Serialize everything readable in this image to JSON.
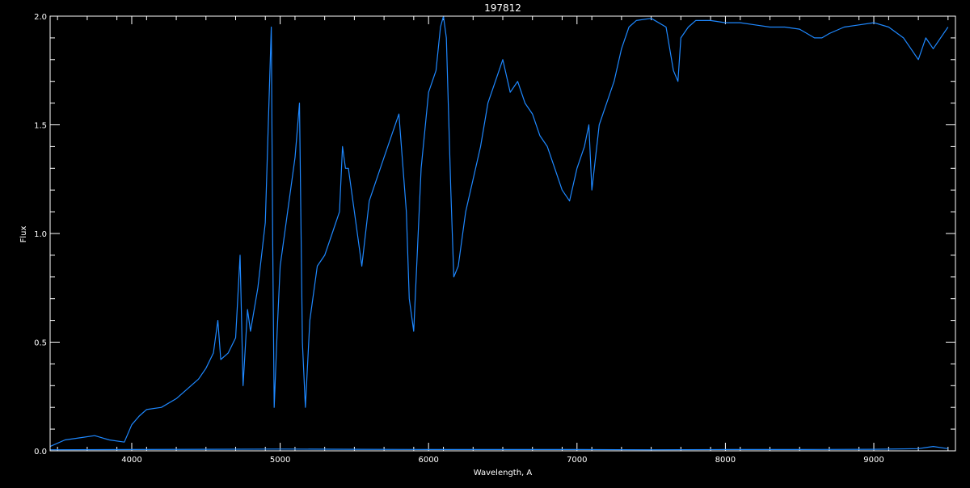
{
  "chart_data": {
    "type": "line",
    "title": "197812",
    "xlabel": "Wavelength, A",
    "ylabel": "Flux",
    "xlim": [
      3450,
      9550
    ],
    "ylim": [
      0.0,
      2.0
    ],
    "x_ticks": [
      {
        "value": 4000,
        "label": "4000"
      },
      {
        "value": 5000,
        "label": "5000"
      },
      {
        "value": 6000,
        "label": "6000"
      },
      {
        "value": 7000,
        "label": "7000"
      },
      {
        "value": 8000,
        "label": "8000"
      },
      {
        "value": 9000,
        "label": "9000"
      }
    ],
    "y_ticks": [
      {
        "value": 0.0,
        "label": "0.0"
      },
      {
        "value": 0.5,
        "label": "0.5"
      },
      {
        "value": 1.0,
        "label": "1.0"
      },
      {
        "value": 1.5,
        "label": "1.5"
      },
      {
        "value": 2.0,
        "label": "2.0"
      }
    ],
    "grid": false,
    "colors": {
      "background": "#000000",
      "axes": "#ffffff",
      "series": "#1e88ff"
    },
    "series": [
      {
        "x": [
          3450,
          3550,
          3650,
          3750,
          3850,
          3950,
          4000,
          4050,
          4100,
          4200,
          4300,
          4400,
          4450,
          4500,
          4550,
          4580,
          4600,
          4650,
          4700,
          4730,
          4750,
          4780,
          4800,
          4850,
          4900,
          4920,
          4940,
          4950,
          4960,
          4980,
          5000,
          5050,
          5100,
          5130,
          5150,
          5170,
          5200,
          5250,
          5300,
          5350,
          5400,
          5420,
          5440,
          5460,
          5500,
          5550,
          5600,
          5650,
          5700,
          5750,
          5800,
          5850,
          5870,
          5900,
          5920,
          5950,
          6000,
          6050,
          6080,
          6100,
          6120,
          6150,
          6170,
          6200,
          6250,
          6300,
          6350,
          6400,
          6450,
          6500,
          6550,
          6600,
          6650,
          6700,
          6750,
          6800,
          6850,
          6900,
          6950,
          7000,
          7050,
          7080,
          7100,
          7150,
          7200,
          7250,
          7300,
          7350,
          7400,
          7500,
          7600,
          7650,
          7680,
          7700,
          7750,
          7800,
          7900,
          8000,
          8100,
          8200,
          8300,
          8400,
          8500,
          8600,
          8650,
          8700,
          8800,
          8900,
          9000,
          9100,
          9200,
          9250,
          9300,
          9350,
          9400,
          9450,
          9500
        ],
        "y": [
          0.02,
          0.05,
          0.06,
          0.07,
          0.05,
          0.04,
          0.12,
          0.16,
          0.19,
          0.2,
          0.24,
          0.3,
          0.33,
          0.38,
          0.45,
          0.6,
          0.42,
          0.45,
          0.52,
          0.9,
          0.3,
          0.65,
          0.55,
          0.75,
          1.05,
          1.5,
          1.95,
          0.95,
          0.2,
          0.55,
          0.85,
          1.1,
          1.35,
          1.6,
          0.5,
          0.2,
          0.6,
          0.85,
          0.9,
          1.0,
          1.1,
          1.4,
          1.3,
          1.3,
          1.1,
          0.85,
          1.15,
          1.25,
          1.35,
          1.45,
          1.55,
          1.1,
          0.7,
          0.55,
          0.85,
          1.3,
          1.65,
          1.75,
          1.95,
          2.0,
          1.9,
          1.2,
          0.8,
          0.85,
          1.1,
          1.25,
          1.4,
          1.6,
          1.7,
          1.8,
          1.65,
          1.7,
          1.6,
          1.55,
          1.45,
          1.4,
          1.3,
          1.2,
          1.15,
          1.3,
          1.4,
          1.5,
          1.2,
          1.5,
          1.6,
          1.7,
          1.85,
          1.95,
          1.98,
          1.99,
          1.95,
          1.75,
          1.7,
          1.9,
          1.95,
          1.98,
          1.98,
          1.97,
          1.97,
          1.96,
          1.95,
          1.95,
          1.94,
          1.9,
          1.9,
          1.92,
          1.95,
          1.96,
          1.97,
          1.95,
          1.9,
          1.85,
          1.8,
          1.9,
          1.85,
          1.9,
          1.95
        ]
      },
      {
        "x": [
          3450,
          4000,
          4500,
          5000,
          5500,
          6000,
          6500,
          7000,
          7500,
          8000,
          8500,
          9000,
          9300,
          9400,
          9500
        ],
        "y": [
          0.005,
          0.006,
          0.007,
          0.008,
          0.007,
          0.006,
          0.006,
          0.006,
          0.005,
          0.006,
          0.006,
          0.007,
          0.01,
          0.02,
          0.01
        ]
      }
    ]
  }
}
